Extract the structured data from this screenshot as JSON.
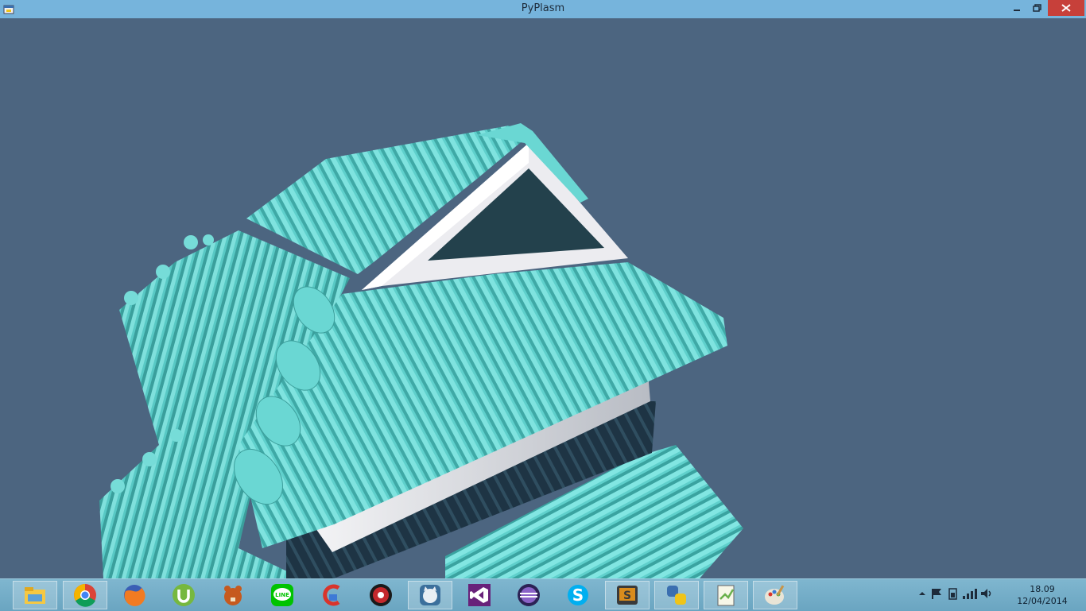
{
  "window": {
    "title": "PyPlasm",
    "icons": {
      "app": "python-window-icon",
      "minimize": "minimize-icon",
      "restore": "restore-icon",
      "close": "close-icon"
    }
  },
  "viewport": {
    "scene": "3d-house-roof-model",
    "colors": {
      "background": "#4c6580",
      "roof_tile": "#5fd0cc",
      "wall": "#e8e8ec",
      "window": "#23414c",
      "fence": "#1e3444"
    }
  },
  "taskbar": {
    "apps": [
      {
        "icon": "file-explorer-icon",
        "active": true
      },
      {
        "icon": "chrome-icon",
        "active": true
      },
      {
        "icon": "firefox-icon",
        "active": false
      },
      {
        "icon": "utorrent-icon",
        "active": false
      },
      {
        "icon": "beaver-icon",
        "active": false
      },
      {
        "icon": "line-icon",
        "active": false
      },
      {
        "icon": "ccleaner-icon",
        "active": false
      },
      {
        "icon": "media-player-icon",
        "active": false
      },
      {
        "icon": "cat-app-icon",
        "active": true
      },
      {
        "icon": "visual-studio-icon",
        "active": false
      },
      {
        "icon": "eclipse-icon",
        "active": false
      },
      {
        "icon": "skype-icon",
        "active": false
      },
      {
        "icon": "sublime-text-icon",
        "active": true
      },
      {
        "icon": "python-icon",
        "active": true
      },
      {
        "icon": "notepadpp-icon",
        "active": true
      },
      {
        "icon": "paint-icon",
        "active": true
      }
    ],
    "tray": {
      "icons": [
        "show-hidden-icons-icon",
        "action-center-flag-icon",
        "battery-icon",
        "network-signal-icon",
        "volume-icon"
      ],
      "time": "18.09",
      "date": "12/04/2014"
    }
  }
}
